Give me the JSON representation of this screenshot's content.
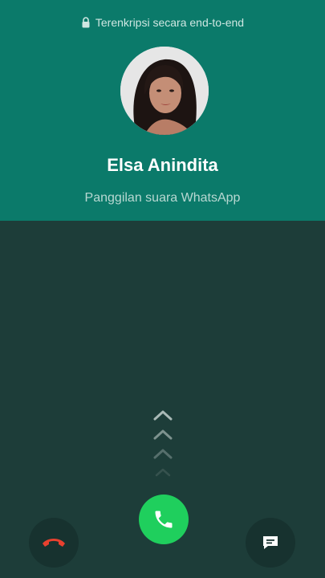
{
  "header": {
    "encryption_text": "Terenkripsi secara end-to-end",
    "caller_name": "Elsa Anindita",
    "call_type": "Panggilan suara WhatsApp"
  },
  "colors": {
    "header_bg": "#0b7a6a",
    "body_bg": "#1d3d39",
    "accept": "#1fcf5d",
    "decline_icon": "#e8412f"
  },
  "controls": {
    "accept_icon": "phone-icon",
    "decline_icon": "phone-hangup-icon",
    "message_icon": "message-icon",
    "swipe_hint_icon": "chevron-up-icon"
  }
}
